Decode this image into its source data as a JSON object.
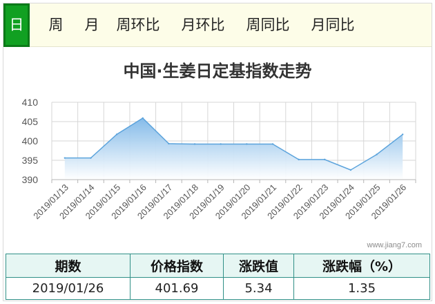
{
  "tabs": [
    {
      "label": "日",
      "active": true
    },
    {
      "label": "周",
      "active": false
    },
    {
      "label": "月",
      "active": false
    },
    {
      "label": "周环比",
      "active": false
    },
    {
      "label": "月环比",
      "active": false
    },
    {
      "label": "周同比",
      "active": false
    },
    {
      "label": "月同比",
      "active": false
    }
  ],
  "colors": {
    "tab_active_bg": "#11a022",
    "tab_bar_bg": "#fdfde8",
    "series_line": "#5ba3dc",
    "area_top": "#7fb8e8",
    "area_bottom": "#ffffff",
    "table_border": "#2f8f86",
    "table_header_bg": "#e6f6f3"
  },
  "watermark": "www.jiang7.com",
  "chart_data": {
    "type": "area",
    "title": "中国·生姜日定基指数走势",
    "x": [
      "2019/01/13",
      "2019/01/14",
      "2019/01/15",
      "2019/01/16",
      "2019/01/17",
      "2019/01/18",
      "2019/01/19",
      "2019/01/20",
      "2019/01/21",
      "2019/01/22",
      "2019/01/23",
      "2019/01/24",
      "2019/01/25",
      "2019/01/26"
    ],
    "y_ticks": [
      "410",
      "405",
      "400",
      "395",
      "390"
    ],
    "ylim": [
      390,
      410
    ],
    "series": [
      {
        "values": [
          395.6,
          395.6,
          401.7,
          405.9,
          399.3,
          399.2,
          399.2,
          399.2,
          399.2,
          395.2,
          395.2,
          392.5,
          396.5,
          401.69
        ]
      }
    ],
    "grid": true,
    "legend": "none",
    "x_label_rotation": "-45deg"
  },
  "summary_table": {
    "headers": [
      "期数",
      "价格指数",
      "涨跌值",
      "涨跌幅（%）"
    ],
    "row": [
      "2019/01/26",
      "401.69",
      "5.34",
      "1.35"
    ]
  }
}
